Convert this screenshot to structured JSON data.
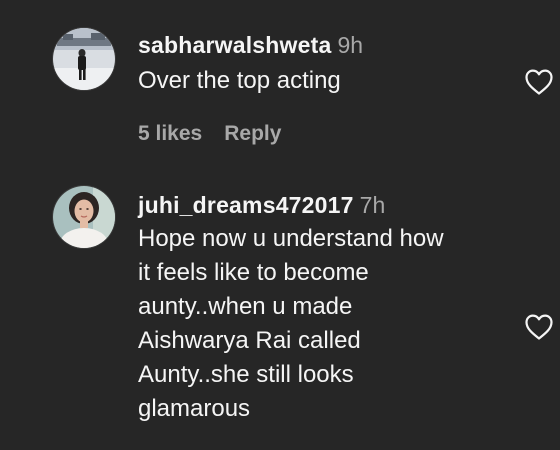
{
  "comments": [
    {
      "username": "sabharwalshweta",
      "time": "9h",
      "text": "Over the top acting",
      "likes": "5 likes",
      "reply": "Reply",
      "avatar": "photo-person-snow",
      "like_icon": "heart-outline-icon"
    },
    {
      "username": "juhi_dreams472017",
      "time": "7h",
      "text": "Hope now u understand how\nit feels like to become\naunty..when u made\nAishwarya Rai called\nAunty..she still looks\nglamarous",
      "avatar": "photo-woman-portrait",
      "like_icon": "heart-outline-icon"
    }
  ],
  "colors": {
    "background": "#262626",
    "primary_text": "#f5f5f5",
    "secondary_text": "#a8a8a8"
  }
}
